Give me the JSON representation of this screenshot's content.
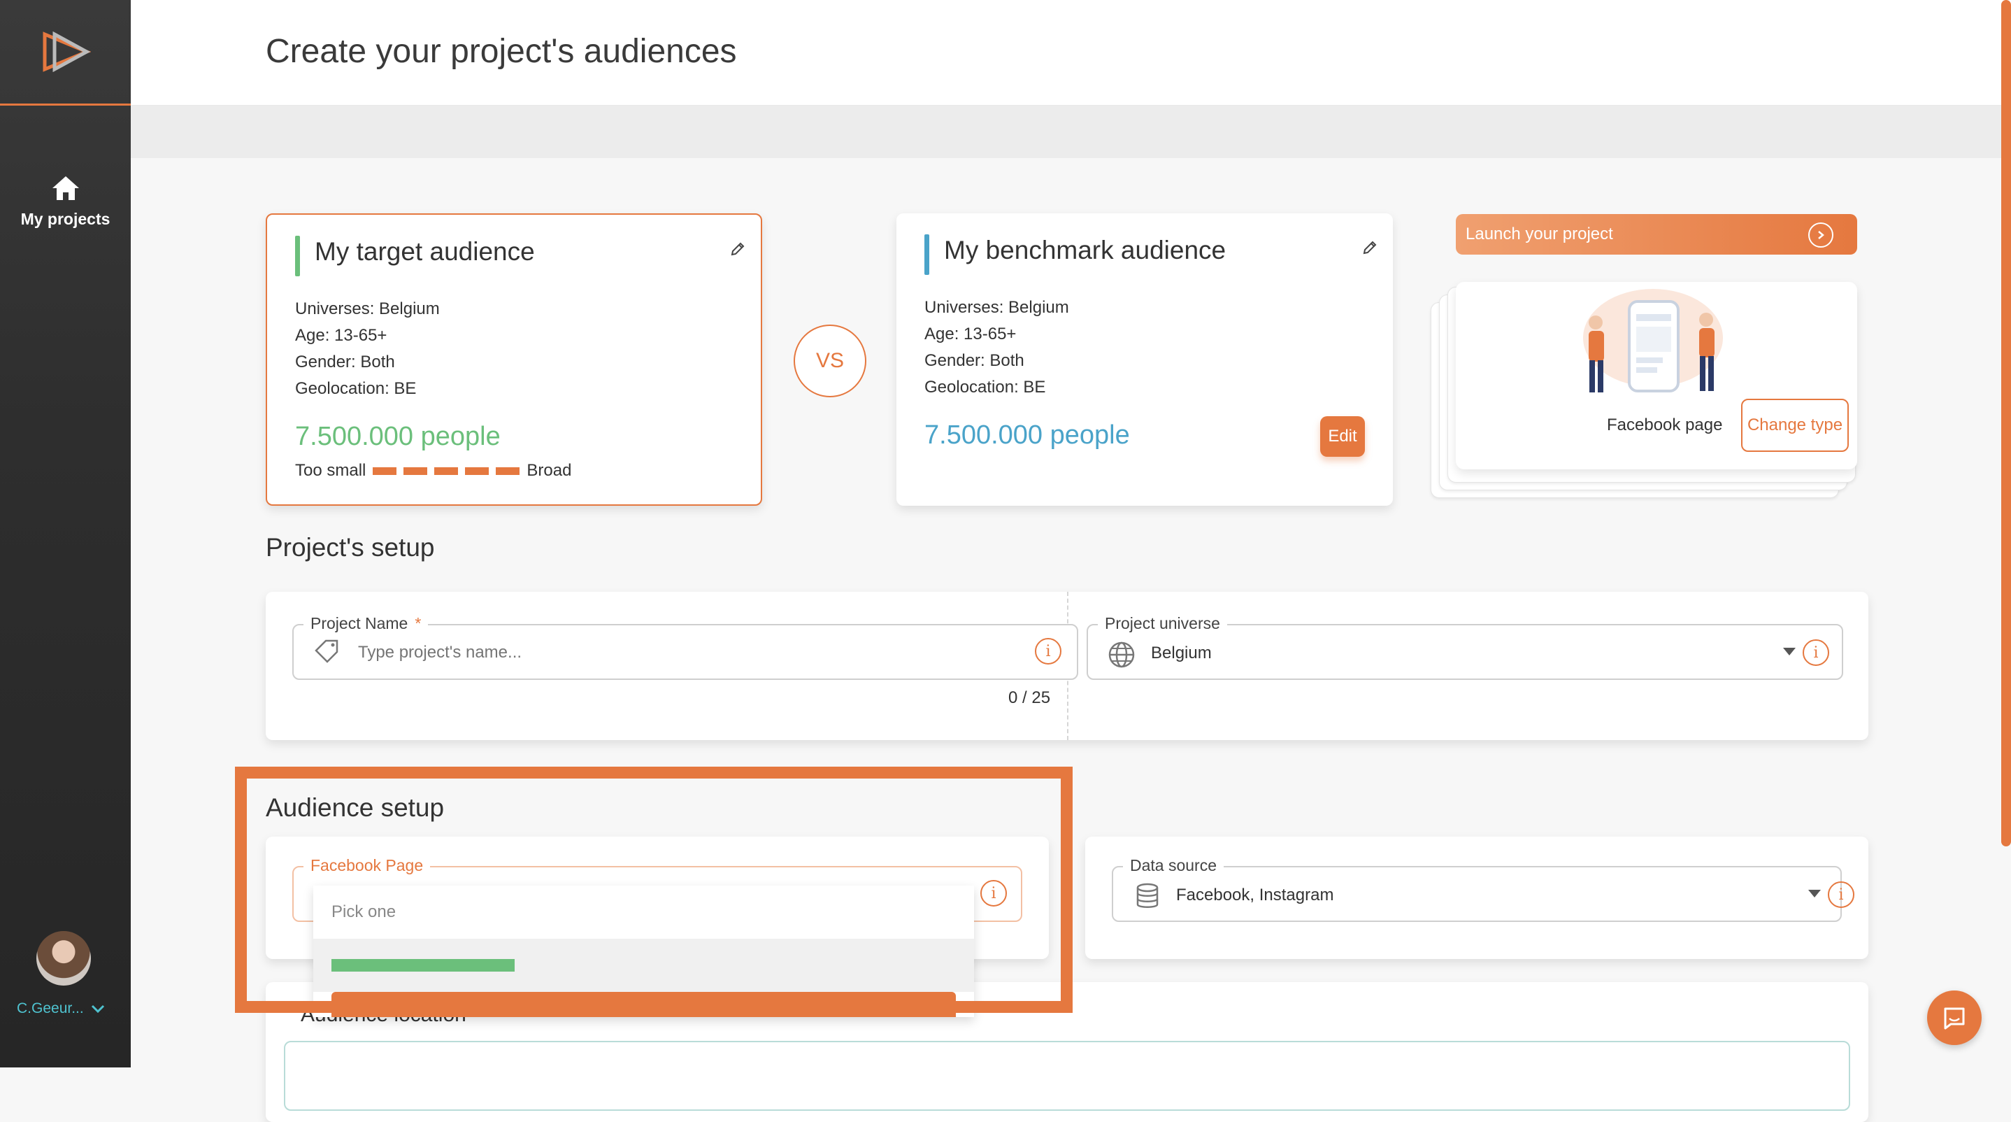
{
  "page_title": "Create your project's audiences",
  "sidebar": {
    "nav_home_label": "My projects",
    "user_name": "C.Geeur..."
  },
  "target_audience": {
    "title": "My target audience",
    "universes": "Universes: Belgium",
    "age": "Age: 13-65+",
    "gender": "Gender: Both",
    "geolocation": "Geolocation: BE",
    "people": "7.500.000 people",
    "meter_low": "Too small",
    "meter_high": "Broad",
    "accent": "#6bbf7b"
  },
  "vs_label": "VS",
  "benchmark_audience": {
    "title": "My benchmark audience",
    "universes": "Universes: Belgium",
    "age": "Age: 13-65+",
    "gender": "Gender: Both",
    "geolocation": "Geolocation: BE",
    "people": "7.500.000 people",
    "edit_label": "Edit",
    "accent": "#4aa3c9"
  },
  "launch_label": "Launch your project",
  "project_type": {
    "label": "Facebook page",
    "change_label": "Change type"
  },
  "project_setup": {
    "title": "Project's setup",
    "name_legend": "Project Name",
    "name_required": "*",
    "name_placeholder": "Type project's name...",
    "name_counter": "0 / 25",
    "universe_legend": "Project universe",
    "universe_value": "Belgium"
  },
  "audience_setup": {
    "title": "Audience setup",
    "facebook_page_legend": "Facebook Page",
    "dropdown_placeholder": "Pick one",
    "data_source_legend": "Data source",
    "data_source_value": "Facebook, Instagram"
  },
  "audience_location": {
    "title": "Audience location"
  },
  "colors": {
    "brand": "#e5783f",
    "sidebar_bg": "#2e2e2e",
    "user_name": "#4fc3d0"
  }
}
